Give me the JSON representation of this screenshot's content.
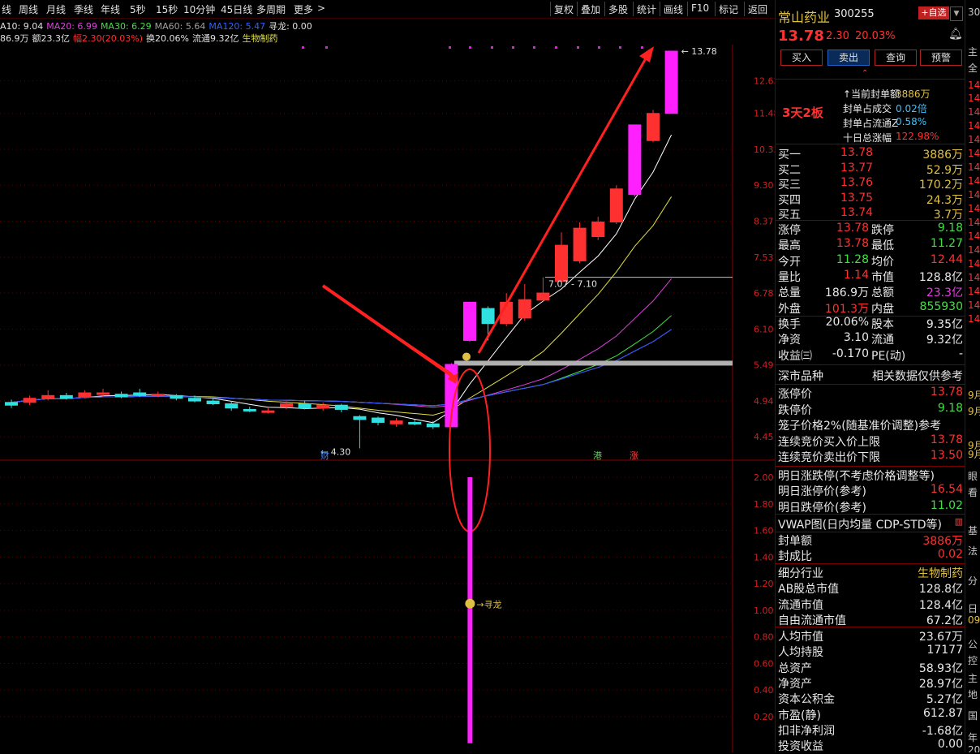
{
  "toolbar": {
    "left": [
      "线",
      "周线",
      "月线",
      "季线",
      "年线",
      "5秒",
      "15秒",
      "10分钟",
      "45日线",
      "多周期",
      "更多"
    ],
    "right": [
      "复权",
      "叠加",
      "多股",
      "统计",
      "画线",
      "F10",
      "标记",
      "返回"
    ]
  },
  "ma_line": [
    {
      "text": "A10: 9.04",
      "color": "#e0e0e0"
    },
    {
      "text": "MA20: 6.99",
      "color": "#e040e0"
    },
    {
      "text": "MA30: 6.29",
      "color": "#40e040"
    },
    {
      "text": "MA60: 5.64",
      "color": "#a0a0a0"
    },
    {
      "text": "MA120: 5.47",
      "color": "#3060ff"
    },
    {
      "text": "寻龙: 0.00",
      "color": "#e0e0e0"
    }
  ],
  "info_line": [
    {
      "text": "86.9万",
      "color": "#e0e0e0"
    },
    {
      "text": "额23.3亿",
      "color": "#e0e0e0"
    },
    {
      "text": "幅2.30(20.03%)",
      "color": "#ff3030"
    },
    {
      "text": "换20.06%",
      "color": "#e0e0e0"
    },
    {
      "text": "流通9.32亿",
      "color": "#e0e0e0"
    },
    {
      "text": "生物制药",
      "color": "#e0e040"
    }
  ],
  "chart_data": {
    "type": "candlestick",
    "y_ticks_price": [
      "12.63",
      "11.48",
      "10.33",
      "9.30",
      "8.37",
      "7.53",
      "6.78",
      "6.10",
      "5.49",
      "4.94",
      "4.45"
    ],
    "y_ticks_indicator": [
      "2.00",
      "1.80",
      "1.60",
      "1.40",
      "1.20",
      "1.00",
      "0.80",
      "0.60",
      "0.40",
      "0.20"
    ],
    "candles": [
      {
        "o": 4.88,
        "c": 4.92,
        "h": 4.96,
        "l": 4.84,
        "up": false
      },
      {
        "o": 4.92,
        "c": 4.98,
        "h": 5.02,
        "l": 4.88,
        "up": true
      },
      {
        "o": 4.98,
        "c": 5.02,
        "h": 5.1,
        "l": 4.95,
        "up": true
      },
      {
        "o": 5.02,
        "c": 4.98,
        "h": 5.06,
        "l": 4.96,
        "up": false
      },
      {
        "o": 5.0,
        "c": 5.06,
        "h": 5.1,
        "l": 4.98,
        "up": true
      },
      {
        "o": 5.06,
        "c": 5.04,
        "h": 5.12,
        "l": 5.0,
        "up": true
      },
      {
        "o": 5.04,
        "c": 5.0,
        "h": 5.08,
        "l": 4.98,
        "up": false
      },
      {
        "o": 5.02,
        "c": 5.06,
        "h": 5.12,
        "l": 5.0,
        "up": false
      },
      {
        "o": 5.04,
        "c": 5.02,
        "h": 5.08,
        "l": 5.0,
        "up": true
      },
      {
        "o": 5.02,
        "c": 4.98,
        "h": 5.04,
        "l": 4.95,
        "up": false
      },
      {
        "o": 4.98,
        "c": 4.94,
        "h": 5.02,
        "l": 4.92,
        "up": false
      },
      {
        "o": 4.94,
        "c": 4.9,
        "h": 4.97,
        "l": 4.88,
        "up": false
      },
      {
        "o": 4.9,
        "c": 4.84,
        "h": 4.94,
        "l": 4.8,
        "up": false
      },
      {
        "o": 4.82,
        "c": 4.8,
        "h": 4.86,
        "l": 4.78,
        "up": false
      },
      {
        "o": 4.8,
        "c": 4.78,
        "h": 4.84,
        "l": 4.76,
        "up": true
      },
      {
        "o": 4.86,
        "c": 4.9,
        "h": 4.94,
        "l": 4.82,
        "up": true
      },
      {
        "o": 4.9,
        "c": 4.84,
        "h": 4.94,
        "l": 4.82,
        "up": false
      },
      {
        "o": 4.84,
        "c": 4.88,
        "h": 4.92,
        "l": 4.8,
        "up": true
      },
      {
        "o": 4.88,
        "c": 4.82,
        "h": 4.9,
        "l": 4.78,
        "up": false
      },
      {
        "o": 4.72,
        "c": 4.68,
        "h": 4.74,
        "l": 4.3,
        "up": false
      },
      {
        "o": 4.7,
        "c": 4.64,
        "h": 4.72,
        "l": 4.6,
        "up": false
      },
      {
        "o": 4.62,
        "c": 4.66,
        "h": 4.7,
        "l": 4.58,
        "up": true
      },
      {
        "o": 4.64,
        "c": 4.62,
        "h": 4.68,
        "l": 4.6,
        "up": false
      },
      {
        "o": 4.62,
        "c": 4.58,
        "h": 4.66,
        "l": 4.55,
        "up": false
      },
      {
        "o": 4.58,
        "c": 5.5,
        "h": 5.52,
        "l": 4.58,
        "up": true,
        "limit": true
      },
      {
        "o": 5.9,
        "c": 6.6,
        "h": 6.6,
        "l": 5.88,
        "up": true,
        "limit": true
      },
      {
        "o": 6.2,
        "c": 6.48,
        "h": 6.52,
        "l": 5.9,
        "up": false
      },
      {
        "o": 6.2,
        "c": 6.6,
        "h": 6.78,
        "l": 6.15,
        "up": true
      },
      {
        "o": 6.3,
        "c": 6.65,
        "h": 6.96,
        "l": 6.25,
        "up": true
      },
      {
        "o": 6.64,
        "c": 6.78,
        "h": 7.1,
        "l": 6.6,
        "up": true
      },
      {
        "o": 7.02,
        "c": 7.8,
        "h": 8.1,
        "l": 7.0,
        "up": true
      },
      {
        "o": 7.45,
        "c": 8.2,
        "h": 8.34,
        "l": 7.4,
        "up": true
      },
      {
        "o": 8.0,
        "c": 8.35,
        "h": 8.48,
        "l": 7.92,
        "up": true
      },
      {
        "o": 8.35,
        "c": 9.2,
        "h": 9.3,
        "l": 8.3,
        "up": true
      },
      {
        "o": 9.05,
        "c": 11.1,
        "h": 11.1,
        "l": 9.0,
        "up": true,
        "limit": true
      },
      {
        "o": 10.6,
        "c": 11.48,
        "h": 11.6,
        "l": 10.55,
        "up": true
      },
      {
        "o": 11.48,
        "c": 13.78,
        "h": 13.78,
        "l": 11.48,
        "up": true,
        "limit": true
      }
    ],
    "annotations": {
      "high": "13.78",
      "low": "4.30",
      "mid": "7.07 - 7.10",
      "flag_text": "寻龙",
      "markers": [
        "财",
        "港",
        "涨"
      ]
    },
    "indicator_bar": {
      "value": 2.0
    }
  },
  "panel": {
    "name": "常山药业",
    "code": "300255",
    "add_fav": "+自选",
    "price": "13.78",
    "change": "2.30",
    "pct": "20.03%",
    "buttons": [
      "买入",
      "卖出",
      "查询",
      "预警"
    ],
    "board": "3天2板",
    "seal": [
      {
        "label": "当前封单额",
        "value": "3886万",
        "vcolor": "#e0c040"
      },
      {
        "label": "封单占成交",
        "value": "0.02倍",
        "vcolor": "#40c0ff"
      },
      {
        "label": "封单占流通Z",
        "value": "0.58%",
        "vcolor": "#40c0ff"
      },
      {
        "label": "十日总涨幅",
        "value": "122.98%",
        "vcolor": "#ff3030"
      }
    ],
    "bids": [
      {
        "label": "买一",
        "price": "13.78",
        "vol": "3886万"
      },
      {
        "label": "买二",
        "price": "13.77",
        "vol": "52.9万"
      },
      {
        "label": "买三",
        "price": "13.76",
        "vol": "170.2万"
      },
      {
        "label": "买四",
        "price": "13.75",
        "vol": "24.3万"
      },
      {
        "label": "买五",
        "price": "13.74",
        "vol": "3.7万"
      }
    ],
    "stats": [
      [
        "涨停",
        "13.78",
        "#ff3030",
        "跌停",
        "9.18",
        "#40e040"
      ],
      [
        "最高",
        "13.78",
        "#ff3030",
        "最低",
        "11.27",
        "#40e040"
      ],
      [
        "今开",
        "11.28",
        "#40e040",
        "均价",
        "12.44",
        "#ff3030"
      ],
      [
        "量比",
        "1.14",
        "#ff3030",
        "市值",
        "128.8亿",
        "#e8e8e8"
      ],
      [
        "总量",
        "186.9万",
        "#e8e8e8",
        "总额",
        "23.3亿",
        "#e040e0"
      ],
      [
        "外盘",
        "101.3万",
        "#ff3030",
        "内盘",
        "855930",
        "#40e040"
      ]
    ],
    "stats2": [
      [
        "换手",
        "20.06%",
        "#e8e8e8",
        "股本",
        "9.35亿",
        "#e8e8e8"
      ],
      [
        "净资",
        "3.10",
        "#e8e8e8",
        "流通",
        "9.32亿",
        "#e8e8e8"
      ],
      [
        "收益㈢",
        "-0.170",
        "#e8e8e8",
        "PE(动)",
        "-",
        "#e8e8e8"
      ]
    ],
    "market": {
      "left": "深市品种",
      "right": "相关数据仅供参考"
    },
    "limits": [
      {
        "label": "涨停价",
        "value": "13.78",
        "c": "#ff3030"
      },
      {
        "label": "跌停价",
        "value": "9.18",
        "c": "#40e040"
      },
      {
        "label": "笼子价格2%(随基准价调整)参考",
        "value": "",
        "c": "#e8e8e8"
      },
      {
        "label": "连续竞价买入价上限",
        "value": "13.78",
        "c": "#ff3030"
      },
      {
        "label": "连续竞价卖出价下限",
        "value": "13.50",
        "c": "#ff3030"
      }
    ],
    "tomorrow": [
      {
        "label": "明日涨跌停(不考虑价格调整等)",
        "value": "",
        "c": "#e8e8e8"
      },
      {
        "label": "明日涨停价(参考)",
        "value": "16.54",
        "c": "#ff3030"
      },
      {
        "label": "明日跌停价(参考)",
        "value": "11.02",
        "c": "#40e040"
      }
    ],
    "vwap": "VWAP图(日内均量 CDP-STD等)",
    "seal2": [
      {
        "label": "封单额",
        "value": "3886万",
        "c": "#ff3030"
      },
      {
        "label": "封成比",
        "value": "0.02",
        "c": "#ff3030"
      }
    ],
    "industry": [
      {
        "label": "细分行业",
        "value": "生物制药",
        "c": "#e0c040"
      },
      {
        "label": "AB股总市值",
        "value": "128.8亿",
        "c": "#e8e8e8"
      },
      {
        "label": "流通市值",
        "value": "128.4亿",
        "c": "#e8e8e8"
      },
      {
        "label": "自由流通市值",
        "value": "67.2亿",
        "c": "#e8e8e8"
      }
    ],
    "finance": [
      {
        "label": "人均市值",
        "value": "23.67万",
        "c": "#e8e8e8"
      },
      {
        "label": "人均持股",
        "value": "17177",
        "c": "#e8e8e8"
      },
      {
        "label": "总资产",
        "value": "58.93亿",
        "c": "#e8e8e8"
      },
      {
        "label": "净资产",
        "value": "28.97亿",
        "c": "#e8e8e8"
      },
      {
        "label": "资本公积金",
        "value": "5.27亿",
        "c": "#e8e8e8"
      },
      {
        "label": "市盈(静)",
        "value": "612.87",
        "c": "#e8e8e8"
      },
      {
        "label": "扣非净利润",
        "value": "-1.68亿",
        "c": "#e8e8e8"
      },
      {
        "label": "投资收益",
        "value": "0.00",
        "c": "#e8e8e8"
      }
    ]
  },
  "farright": [
    "30",
    "主",
    "全",
    "14",
    "14",
    "14",
    "14",
    "14",
    "14",
    "14",
    "14",
    "14",
    "14",
    "14",
    "14",
    "14",
    "14",
    "14",
    "14",
    "14",
    "14",
    "9月",
    "9月",
    "9月",
    "9月",
    "眼",
    "看",
    "基",
    "法",
    "分",
    "日",
    "09",
    "公",
    "控",
    "主",
    "地",
    "国",
    "年",
    "20"
  ]
}
